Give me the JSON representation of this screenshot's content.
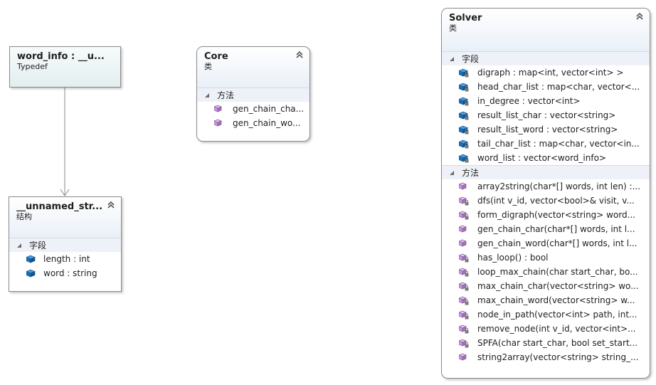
{
  "shapes": {
    "word_info": {
      "title": "word_info : __u...",
      "stereotype": "Typedef"
    },
    "core": {
      "title": "Core",
      "stereotype": "类",
      "methods_label": "方法",
      "methods": [
        "gen_chain_cha...",
        "gen_chain_wo..."
      ]
    },
    "unnamed": {
      "title": "__unnamed_str...",
      "stereotype": "结构",
      "fields_label": "字段",
      "fields": [
        "length : int",
        "word : string"
      ]
    },
    "solver": {
      "title": "Solver",
      "stereotype": "类",
      "fields_label": "字段",
      "fields": [
        "digraph : map<int, vector<int> >",
        "head_char_list : map<char, vector<...",
        "in_degree : vector<int>",
        "result_list_char : vector<string>",
        "result_list_word : vector<string>",
        "tail_char_list : map<char, vector<in...",
        "word_list : vector<word_info>"
      ],
      "methods_label": "方法",
      "methods": [
        "array2string(char*[] words, int len) :...",
        "dfs(int v_id, vector<bool>& visit, v...",
        "form_digraph(vector<string> word...",
        "gen_chain_char(char*[] words, int l...",
        "gen_chain_word(char*[] words, int l...",
        "has_loop() : bool",
        "loop_max_chain(char start_char, bo...",
        "max_chain_char(vector<string> wo...",
        "max_chain_word(vector<string> w...",
        "node_in_path(vector<int> path, int...",
        "remove_node(int v_id, vector<int>...",
        "SPFA(char start_char, bool set_start...",
        "string2array(vector<string> string_..."
      ],
      "method_access": [
        "public",
        "private",
        "private",
        "public",
        "public",
        "private",
        "private",
        "private",
        "private",
        "private",
        "private",
        "private",
        "public"
      ]
    }
  },
  "colors": {
    "header_gradient_end": "#eaf0f8",
    "section_bg": "#eef2f8",
    "field_icon": "#1b6fb5",
    "method_icon": "#a46fb8",
    "connector": "#8a8a8a"
  }
}
